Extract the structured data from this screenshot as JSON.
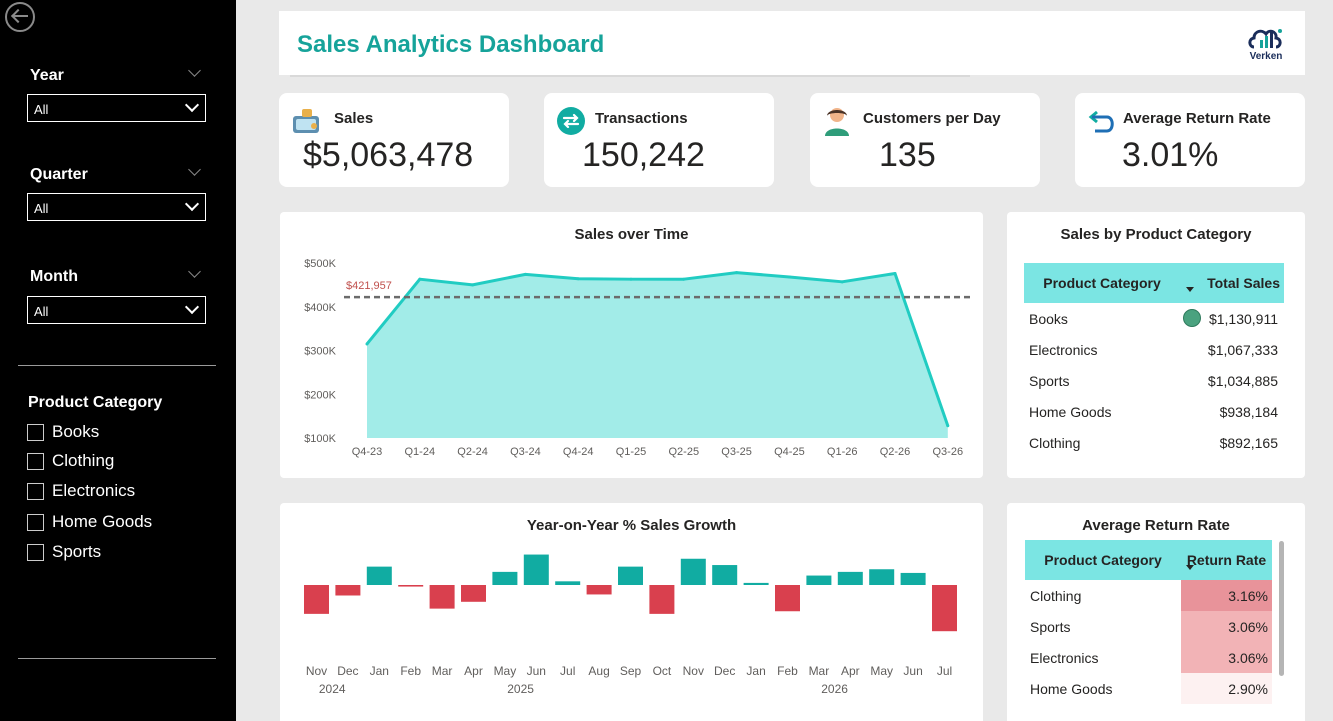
{
  "sidebar": {
    "filters": [
      {
        "label": "Year",
        "value": "All"
      },
      {
        "label": "Quarter",
        "value": "All"
      },
      {
        "label": "Month",
        "value": "All"
      }
    ],
    "category_title": "Product Category",
    "categories": [
      "Books",
      "Clothing",
      "Electronics",
      "Home Goods",
      "Sports"
    ]
  },
  "header": {
    "title": "Sales Analytics Dashboard",
    "logo_text": "Verken"
  },
  "kpis": [
    {
      "label": "Sales",
      "value": "$5,063,478"
    },
    {
      "label": "Transactions",
      "value": "150,242"
    },
    {
      "label": "Customers per Day",
      "value": "135"
    },
    {
      "label": "Average Return Rate",
      "value": "3.01%"
    }
  ],
  "colors": {
    "accent": "#16a39a",
    "teal_line": "#21ccc2",
    "area_fill": "#a2ece8",
    "bar_pos": "#11aca2",
    "bar_neg": "#d9404e",
    "table_header": "#7be5e3"
  },
  "chart_data": [
    {
      "type": "area",
      "title": "Sales over Time",
      "categories": [
        "Q4-23",
        "Q1-24",
        "Q2-24",
        "Q3-24",
        "Q4-24",
        "Q1-25",
        "Q2-25",
        "Q3-25",
        "Q4-25",
        "Q1-26",
        "Q2-26",
        "Q3-26"
      ],
      "values": [
        315000,
        463000,
        450000,
        474000,
        464000,
        463000,
        463000,
        478000,
        468000,
        457000,
        476000,
        128000
      ],
      "average_line": {
        "value": 421957,
        "label": "$421,957"
      },
      "ytick_labels": [
        "$500K",
        "$400K",
        "$300K",
        "$200K",
        "$100K"
      ],
      "ylim": [
        100000,
        500000
      ]
    },
    {
      "type": "bar",
      "title": "Year-on-Year % Sales Growth",
      "categories": [
        "Nov",
        "Dec",
        "Jan",
        "Feb",
        "Mar",
        "Apr",
        "May",
        "Jun",
        "Jul",
        "Aug",
        "Sep",
        "Oct",
        "Nov",
        "Dec",
        "Jan",
        "Feb",
        "Mar",
        "Apr",
        "May",
        "Jun",
        "Jul"
      ],
      "year_labels": [
        {
          "label": "2024",
          "index": 0.5
        },
        {
          "label": "2025",
          "index": 6.5
        },
        {
          "label": "2026",
          "index": 16.5
        }
      ],
      "values": [
        -5.5,
        -2.0,
        3.5,
        -0.3,
        -4.5,
        -3.2,
        2.5,
        5.8,
        0.7,
        -1.8,
        3.5,
        -5.5,
        5.0,
        3.8,
        0.4,
        -5.0,
        1.8,
        2.5,
        3.0,
        2.3,
        -8.8
      ],
      "ylim": [
        -10,
        7
      ]
    }
  ],
  "sales_by_category": {
    "title": "Sales by Product Category",
    "columns": [
      "Product Category",
      "Total Sales"
    ],
    "rows": [
      {
        "category": "Books",
        "sales": "$1,130,911"
      },
      {
        "category": "Electronics",
        "sales": "$1,067,333"
      },
      {
        "category": "Sports",
        "sales": "$1,034,885"
      },
      {
        "category": "Home Goods",
        "sales": "$938,184"
      },
      {
        "category": "Clothing",
        "sales": "$892,165"
      }
    ]
  },
  "return_rate": {
    "title": "Average Return Rate",
    "columns": [
      "Product Category",
      "Return Rate"
    ],
    "rows": [
      {
        "category": "Clothing",
        "rate": "3.16%",
        "shade": "#e8939a"
      },
      {
        "category": "Sports",
        "rate": "3.06%",
        "shade": "#f2b3b6"
      },
      {
        "category": "Electronics",
        "rate": "3.06%",
        "shade": "#f2b3b6"
      },
      {
        "category": "Home Goods",
        "rate": "2.90%",
        "shade": "#fdf1f1"
      }
    ]
  }
}
